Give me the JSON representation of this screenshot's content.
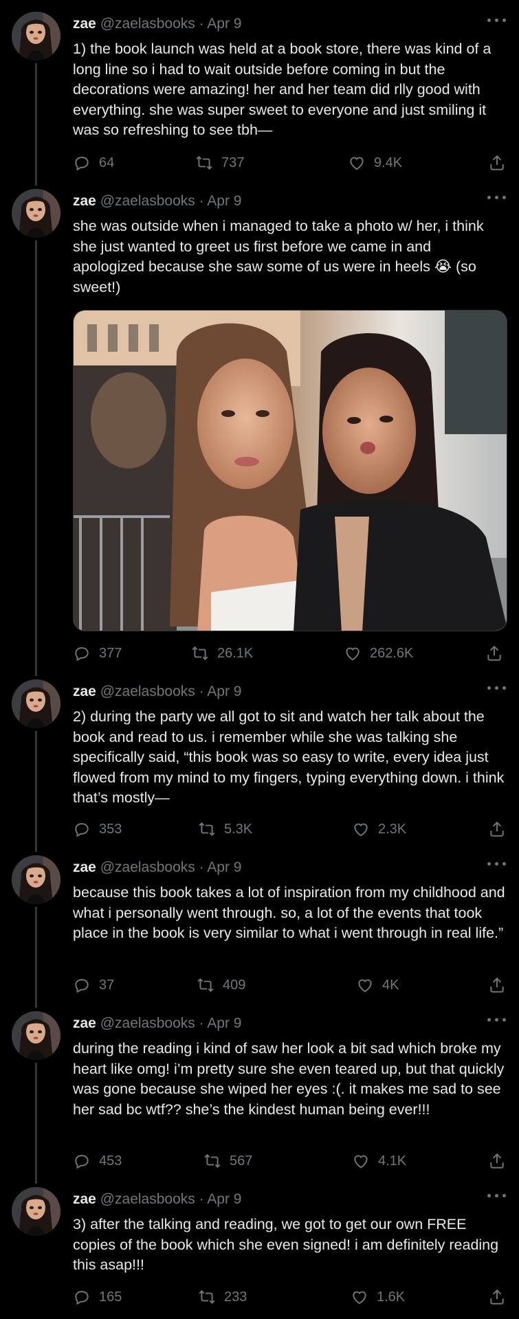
{
  "user": {
    "name": "zae",
    "handle": "@zaelasbooks",
    "separator": "·"
  },
  "tweets": [
    {
      "date": "Apr 9",
      "text": "1) the book launch was held at a book store, there was kind of a long line so i had to wait outside before coming in but the decorations were amazing! her and her team did rlly good with everything. she was super sweet to everyone and just smiling it was so refreshing to see tbh—",
      "replies": "64",
      "retweets": "737",
      "likes": "9.4K"
    },
    {
      "date": "Apr 9",
      "text": "she was outside when i managed to take a photo w/ her, i think she just wanted to greet us first before we came in and apologized because she saw some of us were in heels 😭 (so sweet!)",
      "replies": "377",
      "retweets": "26.1K",
      "likes": "262.6K"
    },
    {
      "date": "Apr 9",
      "text": "2) during the party we all got to sit and watch her talk about the book and read to us. i remember while she was talking she specifically said, “this book was so easy to write, every idea just flowed from my mind to my fingers, typing everything down. i think that’s mostly—",
      "replies": "353",
      "retweets": "5.3K",
      "likes": "2.3K"
    },
    {
      "date": "Apr 9",
      "text": "because this book takes a lot of inspiration from my childhood and what i personally went through. so, a lot of the events that took place in the book is very similar to what i went through in real life.”",
      "replies": "37",
      "retweets": "409",
      "likes": "4K"
    },
    {
      "date": "Apr 9",
      "text": "during the reading i kind of saw her look a bit sad which broke my heart like omg! i’m pretty sure she even teared up, but that quickly was gone because she wiped her eyes :(. it makes me sad to see her sad bc wtf?? she’s the kindest human being ever!!!",
      "replies": "453",
      "retweets": "567",
      "likes": "4.1K"
    },
    {
      "date": "Apr 9",
      "text": "3) after the talking and reading, we got to get our own FREE copies of the book which she even signed! i am definitely reading this asap!!!",
      "replies": "165",
      "retweets": "233",
      "likes": "1.6K"
    }
  ],
  "icons": {
    "reply": "reply-icon",
    "retweet": "retweet-icon",
    "like": "heart-icon",
    "share": "share-icon",
    "more": "more-icon"
  },
  "colors": {
    "background": "#000000",
    "text": "#e7e9ea",
    "muted": "#71767b",
    "thread": "#333639"
  }
}
